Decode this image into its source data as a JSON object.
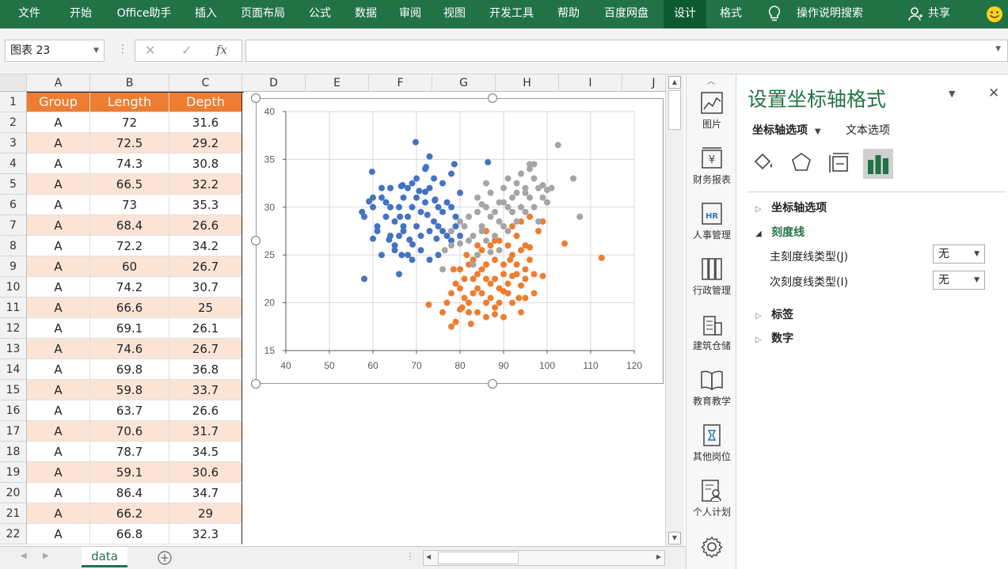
{
  "ribbon": {
    "tabs": [
      "文件",
      "开始",
      "Office助手",
      "插入",
      "页面布局",
      "公式",
      "数据",
      "审阅",
      "视图",
      "开发工具",
      "帮助",
      "百度网盘",
      "设计",
      "格式"
    ],
    "search": "操作说明搜索",
    "share": "共享"
  },
  "formula_bar": {
    "name_box": "图表 23",
    "fx": "fx",
    "formula": ""
  },
  "grid": {
    "columns": [
      "A",
      "B",
      "C",
      "D",
      "E",
      "F",
      "G",
      "H",
      "I",
      "J"
    ],
    "row_numbers": [
      "1",
      "2",
      "3",
      "4",
      "5",
      "6",
      "7",
      "8",
      "9",
      "10",
      "11",
      "12",
      "13",
      "14",
      "15",
      "16",
      "17",
      "18",
      "19",
      "20",
      "21",
      "22"
    ],
    "header": [
      "Group",
      "Length",
      "Depth"
    ],
    "rows": [
      [
        "A",
        "72",
        "31.6"
      ],
      [
        "A",
        "72.5",
        "29.2"
      ],
      [
        "A",
        "74.3",
        "30.8"
      ],
      [
        "A",
        "66.5",
        "32.2"
      ],
      [
        "A",
        "73",
        "35.3"
      ],
      [
        "A",
        "68.4",
        "26.6"
      ],
      [
        "A",
        "72.2",
        "34.2"
      ],
      [
        "A",
        "60",
        "26.7"
      ],
      [
        "A",
        "74.2",
        "30.7"
      ],
      [
        "A",
        "66.6",
        "25"
      ],
      [
        "A",
        "69.1",
        "26.1"
      ],
      [
        "A",
        "74.6",
        "26.7"
      ],
      [
        "A",
        "69.8",
        "36.8"
      ],
      [
        "A",
        "59.8",
        "33.7"
      ],
      [
        "A",
        "63.7",
        "26.6"
      ],
      [
        "A",
        "70.6",
        "31.7"
      ],
      [
        "A",
        "78.7",
        "34.5"
      ],
      [
        "A",
        "59.1",
        "30.6"
      ],
      [
        "A",
        "86.4",
        "34.7"
      ],
      [
        "A",
        "66.2",
        "29"
      ],
      [
        "A",
        "66.8",
        "32.3"
      ]
    ],
    "header_color": "#ed7d31",
    "band_color": "#fbe4d5"
  },
  "sheet_tab": "data",
  "chart_data": {
    "type": "scatter",
    "xlim": [
      40,
      120
    ],
    "ylim": [
      15,
      40
    ],
    "xticks": [
      "40",
      "50",
      "60",
      "70",
      "80",
      "90",
      "100",
      "110",
      "120"
    ],
    "yticks": [
      "15",
      "20",
      "25",
      "30",
      "35",
      "40"
    ],
    "grid": true,
    "series": [
      {
        "color": "#4472c4",
        "points": [
          [
            72,
            31.6
          ],
          [
            72.5,
            29.2
          ],
          [
            74.3,
            30.8
          ],
          [
            66.5,
            32.2
          ],
          [
            73,
            35.3
          ],
          [
            68.4,
            26.6
          ],
          [
            72.2,
            34.2
          ],
          [
            60,
            26.7
          ],
          [
            74.2,
            30.7
          ],
          [
            66.6,
            25
          ],
          [
            69.1,
            26.1
          ],
          [
            74.6,
            26.7
          ],
          [
            69.8,
            36.8
          ],
          [
            59.8,
            33.7
          ],
          [
            63.7,
            26.6
          ],
          [
            70.6,
            31.7
          ],
          [
            78.7,
            34.5
          ],
          [
            59.1,
            30.6
          ],
          [
            86.4,
            34.7
          ],
          [
            66.2,
            29
          ],
          [
            66.8,
            32.3
          ],
          [
            58,
            22.5
          ],
          [
            66,
            23
          ],
          [
            62,
            25
          ],
          [
            65,
            26
          ],
          [
            69,
            24.5
          ],
          [
            71,
            25.5
          ],
          [
            73,
            24.5
          ],
          [
            75,
            25
          ],
          [
            77,
            27
          ],
          [
            79,
            28
          ],
          [
            78,
            30
          ],
          [
            80,
            31.5
          ],
          [
            76,
            32.5
          ],
          [
            75,
            30
          ],
          [
            70,
            28
          ],
          [
            68,
            29
          ],
          [
            63,
            29
          ],
          [
            61,
            28
          ],
          [
            60,
            30
          ],
          [
            62,
            31
          ],
          [
            64,
            32
          ],
          [
            67,
            31
          ],
          [
            70,
            33
          ],
          [
            72,
            34
          ],
          [
            74,
            33
          ],
          [
            76,
            29.5
          ],
          [
            77,
            30.5
          ],
          [
            64,
            27
          ],
          [
            67,
            27.5
          ],
          [
            69,
            30
          ],
          [
            65,
            28.5
          ],
          [
            63,
            30.5
          ],
          [
            71,
            29.5
          ],
          [
            73,
            27.5
          ],
          [
            76,
            27.5
          ],
          [
            78,
            26.5
          ],
          [
            62,
            32
          ],
          [
            66,
            30
          ],
          [
            68,
            32
          ],
          [
            70,
            31
          ],
          [
            72,
            30.5
          ],
          [
            74,
            28.5
          ],
          [
            58,
            29
          ],
          [
            61,
            27.5
          ],
          [
            65,
            25.5
          ],
          [
            68,
            25
          ],
          [
            71,
            27
          ],
          [
            75,
            28
          ],
          [
            79,
            29
          ],
          [
            80,
            27
          ],
          [
            57.5,
            29.5
          ],
          [
            64,
            30
          ],
          [
            67,
            28
          ],
          [
            69,
            32.5
          ],
          [
            73,
            32
          ],
          [
            78,
            33.5
          ],
          [
            60,
            31
          ],
          [
            66,
            27
          ]
        ]
      },
      {
        "color": "#ed7d31",
        "points": [
          [
            72.8,
            19.8
          ],
          [
            78,
            17.5
          ],
          [
            79,
            18
          ],
          [
            80.5,
            19.5
          ],
          [
            82,
            20
          ],
          [
            82.5,
            17.8
          ],
          [
            84,
            19
          ],
          [
            86,
            18.5
          ],
          [
            88,
            19.5
          ],
          [
            90,
            18.5
          ],
          [
            92,
            20
          ],
          [
            94,
            19
          ],
          [
            95,
            20.5
          ],
          [
            78,
            21
          ],
          [
            80,
            21.5
          ],
          [
            81,
            22.5
          ],
          [
            83,
            22.5
          ],
          [
            85,
            21
          ],
          [
            87,
            22
          ],
          [
            89,
            21.5
          ],
          [
            91,
            22
          ],
          [
            93,
            23
          ],
          [
            95,
            22.5
          ],
          [
            97,
            21
          ],
          [
            80,
            23.5
          ],
          [
            82,
            24
          ],
          [
            84,
            23
          ],
          [
            86,
            24
          ],
          [
            88,
            24.5
          ],
          [
            90,
            24
          ],
          [
            92,
            25
          ],
          [
            94,
            25.5
          ],
          [
            96,
            24.5
          ],
          [
            85,
            25.5
          ],
          [
            87,
            26
          ],
          [
            89,
            26.5
          ],
          [
            91,
            26
          ],
          [
            93,
            27
          ],
          [
            95,
            26
          ],
          [
            98,
            27.5
          ],
          [
            99,
            28.5
          ],
          [
            104,
            26.2
          ],
          [
            112.5,
            24.7
          ],
          [
            99,
            22.8
          ],
          [
            76,
            19
          ],
          [
            77,
            20
          ],
          [
            79,
            22
          ],
          [
            83,
            21
          ],
          [
            86,
            20
          ],
          [
            88,
            22.5
          ],
          [
            90,
            23
          ],
          [
            93,
            24
          ],
          [
            95,
            23.5
          ],
          [
            97,
            23
          ],
          [
            84,
            26
          ],
          [
            86,
            27.5
          ],
          [
            88,
            26.5
          ],
          [
            92,
            28
          ],
          [
            94,
            28.5
          ],
          [
            96,
            29
          ],
          [
            83,
            24.5
          ],
          [
            81,
            20.5
          ],
          [
            85,
            23.5
          ],
          [
            87,
            20.5
          ],
          [
            89,
            20
          ],
          [
            91,
            21
          ],
          [
            80,
            19.3
          ],
          [
            82,
            19
          ],
          [
            84,
            21.5
          ],
          [
            86,
            22.5
          ],
          [
            88,
            18.8
          ],
          [
            90,
            21.2
          ],
          [
            92,
            22.8
          ],
          [
            94,
            21.8
          ],
          [
            96,
            25.8
          ],
          [
            78.5,
            23.5
          ],
          [
            81.5,
            25
          ],
          [
            91.5,
            24.5
          ],
          [
            93.5,
            20.5
          ]
        ]
      },
      {
        "color": "#a5a5a5",
        "points": [
          [
            76,
            23.5
          ],
          [
            76.5,
            25.5
          ],
          [
            78,
            27.5
          ],
          [
            80,
            28.5
          ],
          [
            82,
            29
          ],
          [
            83,
            27
          ],
          [
            84,
            29.5
          ],
          [
            85,
            28
          ],
          [
            86,
            30
          ],
          [
            87,
            31.5
          ],
          [
            88,
            29.5
          ],
          [
            89,
            30.5
          ],
          [
            90,
            32
          ],
          [
            91,
            30
          ],
          [
            92,
            31
          ],
          [
            93,
            32.5
          ],
          [
            94,
            33.5
          ],
          [
            95,
            32
          ],
          [
            96,
            34
          ],
          [
            97,
            33
          ],
          [
            98,
            32
          ],
          [
            99,
            31
          ],
          [
            100,
            30.5
          ],
          [
            101,
            32
          ],
          [
            102.5,
            36.5
          ],
          [
            106,
            33
          ],
          [
            107.5,
            29
          ],
          [
            96,
            34.5
          ],
          [
            94,
            30
          ],
          [
            92,
            29.5
          ],
          [
            90,
            28
          ],
          [
            88,
            27
          ],
          [
            86,
            26.5
          ],
          [
            84,
            25
          ],
          [
            83,
            24
          ],
          [
            81,
            28
          ],
          [
            85,
            27.5
          ],
          [
            87,
            29
          ],
          [
            89,
            28.5
          ],
          [
            91,
            27.5
          ],
          [
            93,
            28.5
          ],
          [
            95,
            29.5
          ],
          [
            97,
            30
          ],
          [
            98,
            28.5
          ],
          [
            100,
            31.8
          ],
          [
            90,
            30.5
          ],
          [
            84,
            31
          ],
          [
            86,
            32.5
          ],
          [
            93,
            31.5
          ],
          [
            96,
            31
          ],
          [
            78,
            26
          ],
          [
            82,
            26.5
          ],
          [
            89,
            25.5
          ],
          [
            91,
            33
          ],
          [
            95,
            31.5
          ],
          [
            97,
            34.5
          ],
          [
            99,
            32.3
          ],
          [
            87,
            25.3
          ],
          [
            80,
            26.2
          ],
          [
            85,
            30.3
          ]
        ]
      }
    ]
  },
  "sidebar": {
    "items": [
      "图片",
      "财务报表",
      "人事管理",
      "行政管理",
      "建筑仓储",
      "教育教学",
      "其他岗位",
      "个人计划"
    ]
  },
  "pane": {
    "title": "设置坐标轴格式",
    "tab_axis": "坐标轴选项",
    "tab_text": "文本选项",
    "sections": [
      "坐标轴选项",
      "刻度线",
      "标签",
      "数字"
    ],
    "major_label": "主刻度线类型(J)",
    "major_value": "无",
    "minor_label": "次刻度线类型(I)",
    "minor_value": "无",
    "accent": "#217346"
  }
}
